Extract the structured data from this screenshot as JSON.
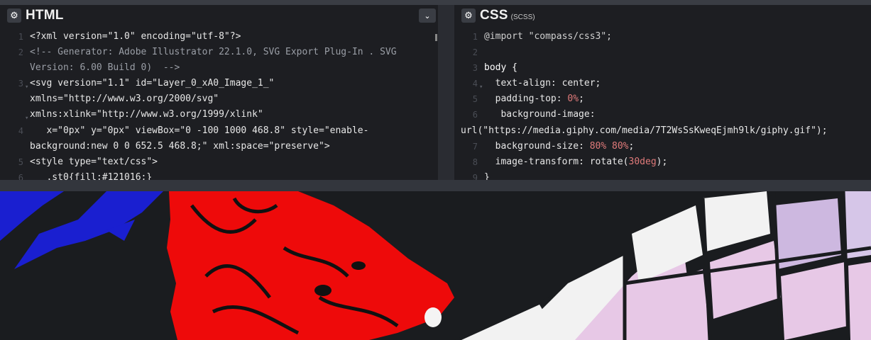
{
  "html_panel": {
    "title": "HTML",
    "gear_icon": "⚙",
    "collapse_icon": "⌄",
    "lines": [
      {
        "num": "1",
        "text": "<?xml version=\"1.0\" encoding=\"utf-8\"?>"
      },
      {
        "num": "2",
        "text": "<!-- Generator: Adobe Illustrator 22.1.0, SVG Export Plug-In . SVG"
      },
      {
        "num": "",
        "text": "Version: 6.00 Build 0)  -->"
      },
      {
        "num": "3",
        "text": "<svg version=\"1.1\" id=\"Layer_0_xA0_Image_1_\""
      },
      {
        "num": "",
        "text": "xmlns=\"http://www.w3.org/2000/svg\""
      },
      {
        "num": "",
        "text": "xmlns:xlink=\"http://www.w3.org/1999/xlink\""
      },
      {
        "num": "4",
        "text": "   x=\"0px\" y=\"0px\" viewBox=\"0 -100 1000 468.8\" style=\"enable-"
      },
      {
        "num": "",
        "text": "background:new 0 0 652.5 468.8;\" xml:space=\"preserve\">"
      },
      {
        "num": "5",
        "text": "<style type=\"text/css\">"
      },
      {
        "num": "6",
        "text": "   .st0{fill:#121016;}"
      }
    ]
  },
  "css_panel": {
    "title": "CSS",
    "subtitle": "(SCSS)",
    "gear_icon": "⚙",
    "lines": [
      {
        "num": "1",
        "text": "@import \"compass/css3\";"
      },
      {
        "num": "2",
        "text": ""
      },
      {
        "num": "3",
        "text": "body {"
      },
      {
        "num": "4",
        "prop": "  text-align",
        "value": "center",
        "end": ";"
      },
      {
        "num": "5",
        "prop": "  padding-top",
        "num_value": "0%",
        "end": ";"
      },
      {
        "num": "6",
        "prop": "   background-image",
        "value": "",
        "end": ""
      },
      {
        "num": "",
        "text": "url(\"https://media.giphy.com/media/7T2WsSsKweqEjmh9lk/giphy.gif\");"
      },
      {
        "num": "7",
        "prop": "  background-size",
        "num_value": "80% 80%",
        "end": ";"
      },
      {
        "num": "8",
        "prop": "  image-transform",
        "value": "rotate(",
        "num_value": "30deg",
        "end": ");"
      },
      {
        "num": "9",
        "text": "}"
      }
    ]
  },
  "colors": {
    "editor_bg": "#1d1e22",
    "preview_bg": "#1a1c1f",
    "blue_shape": "#1a1fd0",
    "red_shape": "#ee0a0a",
    "tile_white": "#f2f2f2",
    "tile_pink": "#e7c8e6"
  }
}
